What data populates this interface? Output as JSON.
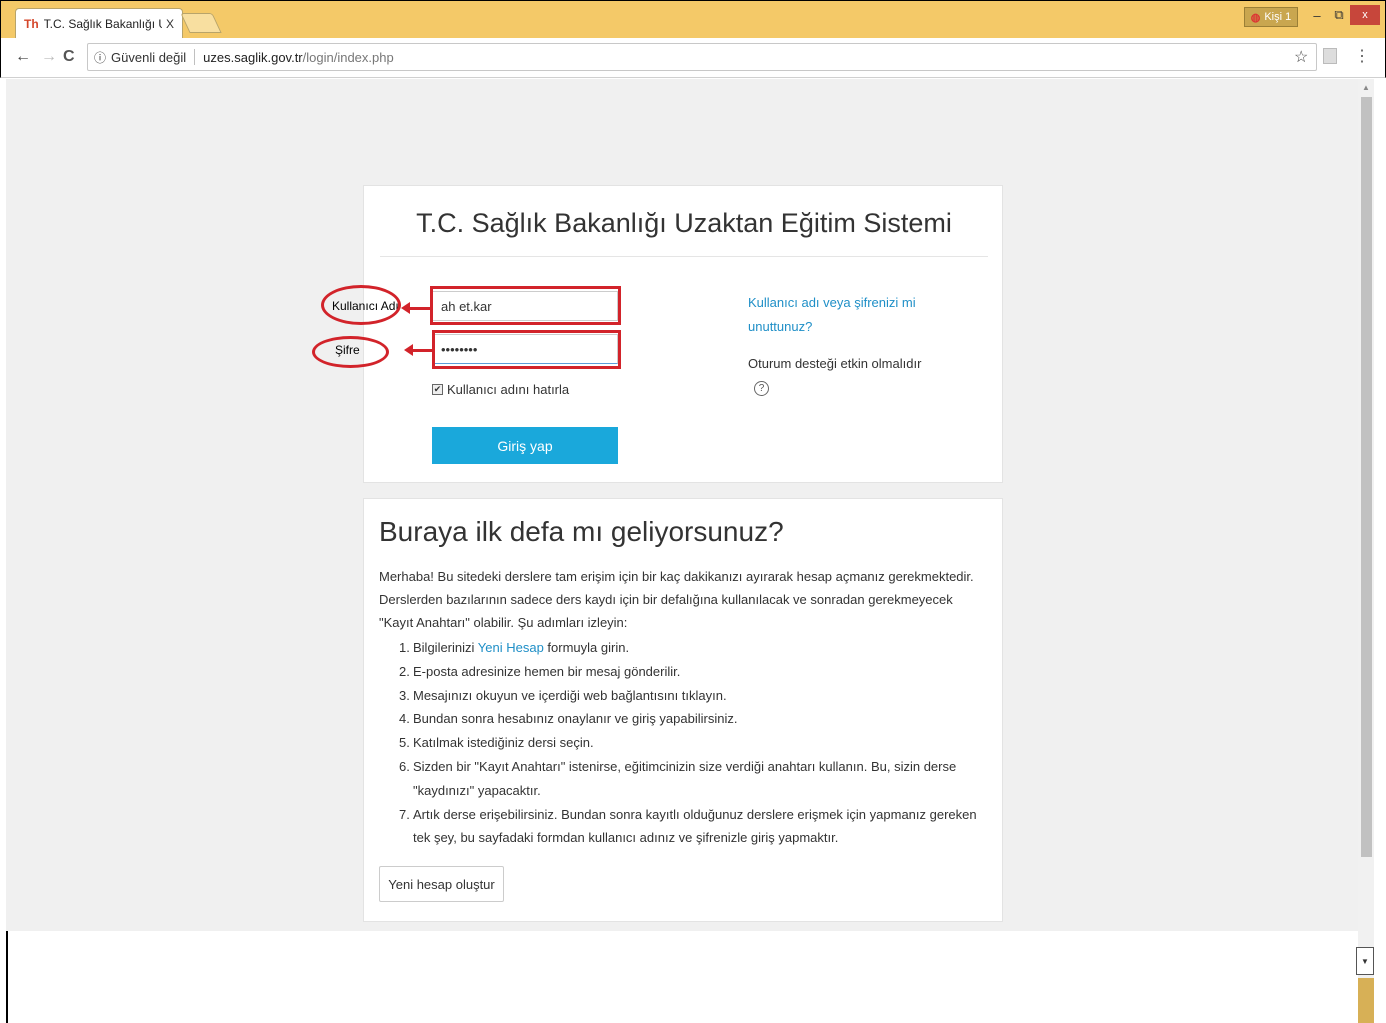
{
  "browser": {
    "tab_title": "T.C. Sağlık Bakanlığı Uza",
    "tab_close": "X",
    "tab_favicon": "Th",
    "profile_label": "Kişi 1",
    "window_min": "–",
    "window_max": "⧉",
    "window_close": "x",
    "security_label": "Güvenli değil",
    "url_host": "uzes.saglik.gov.tr",
    "url_path": "/login/index.php"
  },
  "login": {
    "title": "T.C. Sağlık Bakanlığı Uzaktan Eğitim Sistemi",
    "username_annotation": "Kullanıcı Adı",
    "password_annotation": "Şifre",
    "username_value": "ah  et.kar",
    "password_value": "••••••••",
    "remember_label": "Kullanıcı adını hatırla",
    "remember_checked_mark": "✔",
    "submit_label": "Giriş yap",
    "forgot_label": "Kullanıcı adı veya şifrenizi mi unuttunuz?",
    "session_label": "Oturum desteği etkin olmalıdır",
    "help_glyph": "?"
  },
  "info": {
    "title": "Buraya ilk defa mı geliyorsunuz?",
    "intro": "Merhaba! Bu sitedeki derslere tam erişim için bir kaç dakikanızı ayırarak hesap açmanız gerekmektedir. Derslerden bazılarının sadece ders kaydı için bir defalığına kullanılacak ve sonradan gerekmeyecek \"Kayıt Anahtarı\" olabilir. Şu adımları izleyin:",
    "step1_pre": "Bilgilerinizi ",
    "step1_link": "Yeni Hesap",
    "step1_post": " formuyla girin.",
    "steps": [
      "E-posta adresinize hemen bir mesaj gönderilir.",
      "Mesajınızı okuyun ve içerdiği web bağlantısını tıklayın.",
      "Bundan sonra hesabınız onaylanır ve giriş yapabilirsiniz.",
      "Katılmak istediğiniz dersi seçin.",
      "Sizden bir \"Kayıt Anahtarı\" istenirse, eğitimcinizin size verdiği anahtarı kullanın. Bu, sizin derse \"kaydınızı\" yapacaktır.",
      "Artık derse erişebilirsiniz. Bundan sonra kayıtlı olduğunuz derslere erişmek için yapmanız gereken tek şey, bu sayfadaki formdan kullanıcı adınız ve şifrenizle giriş yapmaktır."
    ],
    "step_numbers": [
      "1.",
      "2.",
      "3.",
      "4.",
      "5.",
      "6.",
      "7."
    ],
    "new_account_label": "Yeni hesap oluştur"
  }
}
